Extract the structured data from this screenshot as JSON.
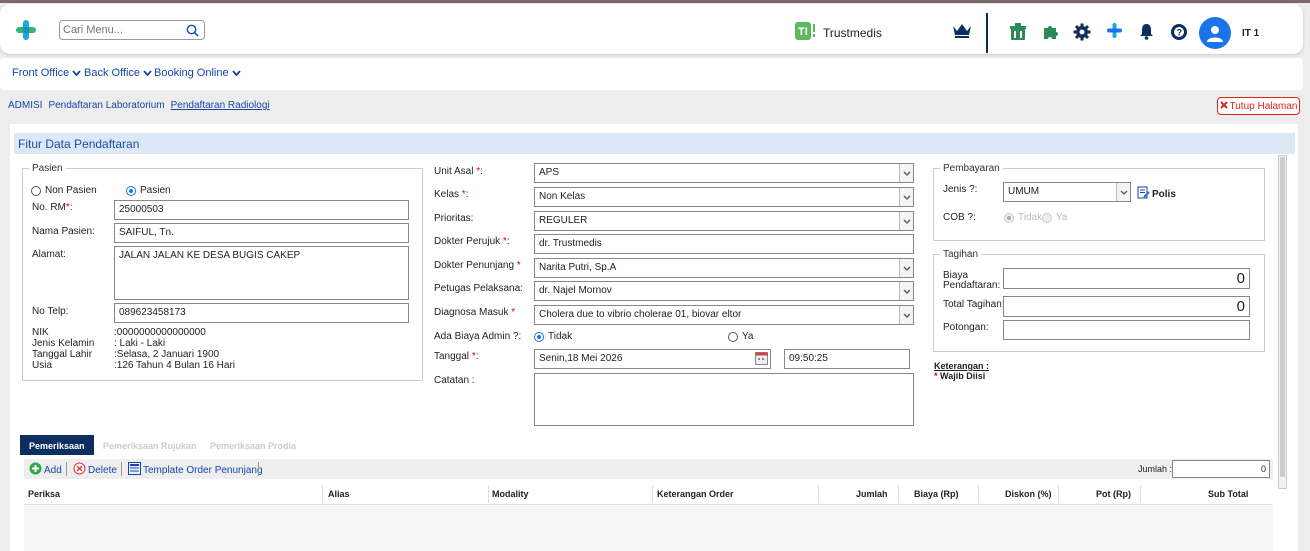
{
  "colors": {
    "accent": "#1a73e8",
    "nav": "#0d2f60",
    "link": "#1546a8",
    "danger": "#dd2222"
  },
  "header": {
    "search_placeholder": "Cari Menu...",
    "brand": "Trustmedis",
    "user": "IT 1",
    "icons": [
      "crown-icon",
      "cart-icon",
      "puzzle-icon",
      "gear-icon",
      "medical-cross-icon",
      "bell-icon",
      "help-icon",
      "user-avatar-icon"
    ]
  },
  "menu": {
    "front_office": "Front Office",
    "back_office": "Back Office",
    "booking_online": "Booking Online"
  },
  "breadcrumbs": {
    "admisi": "ADMISI",
    "lab": "Pendaftaran Laboratorium",
    "radiologi": "Pendaftaran Radiologi"
  },
  "close_label": "Tutup Halaman",
  "form": {
    "title": "Fitur Data Pendaftaran",
    "pasien": {
      "legend": "Pasien",
      "non_pasien": "Non Pasien",
      "pasien": "Pasien",
      "rm_label": "No. RM",
      "rm_value": "25000503",
      "nama_label": "Nama Pasien:",
      "nama_value": "SAIFUL, Tn.",
      "alamat_label": "Alamat:",
      "alamat_value": "JALAN JALAN KE DESA BUGIS CAKEP",
      "telp_label": "No Telp:",
      "telp_value": "089623458173",
      "nik_label": "NIK",
      "nik_value": ":0000000000000000",
      "jk_label": "Jenis Kelamin",
      "jk_value": ": Laki - Laki",
      "tgl_label": "Tanggal Lahir",
      "tgl_value": ":Selasa, 2 Januari 1900",
      "usia_label": "Usia",
      "usia_value": ":126 Tahun 4 Bulan 16 Hari"
    },
    "mid": {
      "unit_label": "Unit Asal",
      "unit_value": "APS",
      "kelas_label": "Kelas",
      "kelas_value": "Non Kelas",
      "prioritas_label": "Prioritas:",
      "prioritas_value": "REGULER",
      "perujuk_label": "Dokter Perujuk",
      "perujuk_value": "dr. Trustmedis",
      "penunjang_label": "Dokter Penunjang",
      "penunjang_value": "Narita Putri, Sp.A",
      "petugas_label": "Petugas Pelaksana:",
      "petugas_value": "dr. Najel Mornov",
      "diagnosa_label": "Diagnosa Masuk",
      "diagnosa_value": "Cholera due to vibrio cholerae 01, biovar eltor",
      "admin_label": "Ada Biaya Admin ?:",
      "admin_tidak": "Tidak",
      "admin_ya": "Ya",
      "tanggal_label": "Tanggal",
      "tanggal_value": "Senin,18 Mei 2026",
      "jam_value": "09:50:25",
      "catatan_label": "Catatan :"
    },
    "pembayaran": {
      "legend": "Pembayaran",
      "jenis_label": "Jenis ?:",
      "jenis_value": "UMUM",
      "polis": "Polis",
      "cob_label": "COB ?:",
      "cob_tidak": "Tidak",
      "cob_ya": "Ya"
    },
    "tagihan": {
      "legend": "Tagihan",
      "biaya_label_1": "Biaya",
      "biaya_label_2": "Pendaftaran:",
      "biaya_value": "0",
      "total_label": "Total Tagihan:",
      "total_value": "0",
      "potongan_label": "Potongan:"
    },
    "keterangan": {
      "title": "Keterangan :",
      "wajib": "Wajib Diisi"
    }
  },
  "tabs": [
    "Pemeriksaan",
    "Pemeriksaan Rujukan",
    "Pemeriksaan Prodia"
  ],
  "toolbar": {
    "add": "Add",
    "delete": "Delete",
    "template": "Template Order Penunjang",
    "jumlah_label": "Jumlah :",
    "jumlah_value": "0"
  },
  "table": {
    "columns": [
      "Periksa",
      "Alias",
      "Modality",
      "Keterangan Order",
      "Jumlah",
      "Biaya (Rp)",
      "Diskon (%)",
      "Pot (Rp)",
      "Sub Total"
    ]
  }
}
